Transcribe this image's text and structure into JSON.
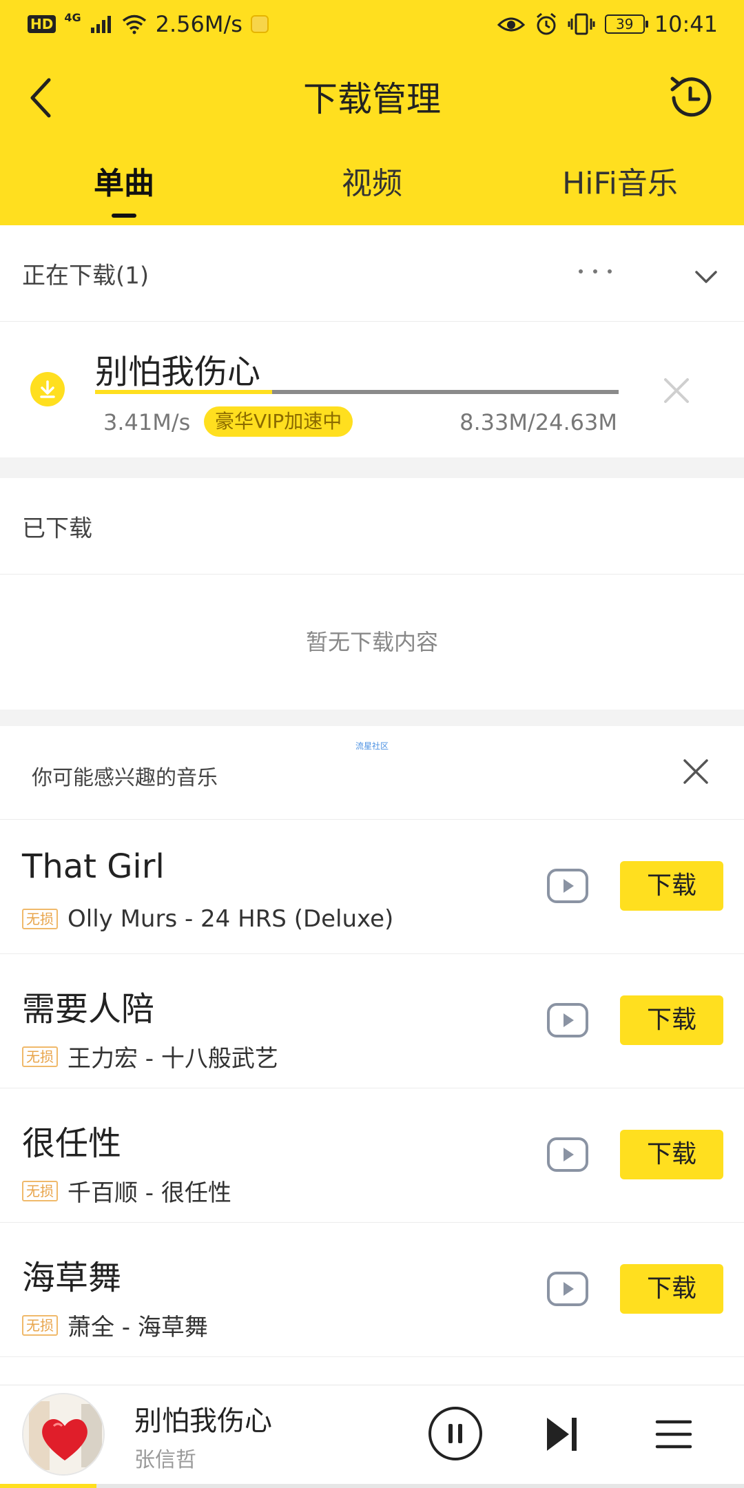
{
  "status_bar": {
    "hd": "HD",
    "network": "4G",
    "speed": "2.56M/s",
    "battery": "39",
    "time": "10:41"
  },
  "header": {
    "title": "下载管理",
    "tabs": [
      {
        "label": "单曲",
        "active": true
      },
      {
        "label": "视频",
        "active": false
      },
      {
        "label": "HiFi音乐",
        "active": false
      }
    ]
  },
  "downloading": {
    "section_label": "正在下载(1)",
    "item": {
      "title": "别怕我伤心",
      "speed": "3.41M/s",
      "vip_badge": "豪华VIP加速中",
      "size": "8.33M/24.63M",
      "progress": 0.338
    }
  },
  "downloaded": {
    "section_label": "已下载",
    "empty_text": "暂无下载内容"
  },
  "recommend": {
    "community_label": "流星社区",
    "title": "你可能感兴趣的音乐",
    "lossless_label": "无损",
    "download_label": "下载",
    "songs": [
      {
        "title": "That Girl",
        "artist": "Olly Murs - 24 HRS (Deluxe)"
      },
      {
        "title": "需要人陪",
        "artist": "王力宏 - 十八般武艺"
      },
      {
        "title": "很任性",
        "artist": "千百顺 - 很任性"
      },
      {
        "title": "海草舞",
        "artist": "萧全 - 海草舞"
      }
    ]
  },
  "player": {
    "title": "别怕我伤心",
    "artist": "张信哲",
    "progress": 0.13
  },
  "colors": {
    "brand_yellow": "#ffdf1f",
    "lossless_orange": "#e8a44a"
  }
}
